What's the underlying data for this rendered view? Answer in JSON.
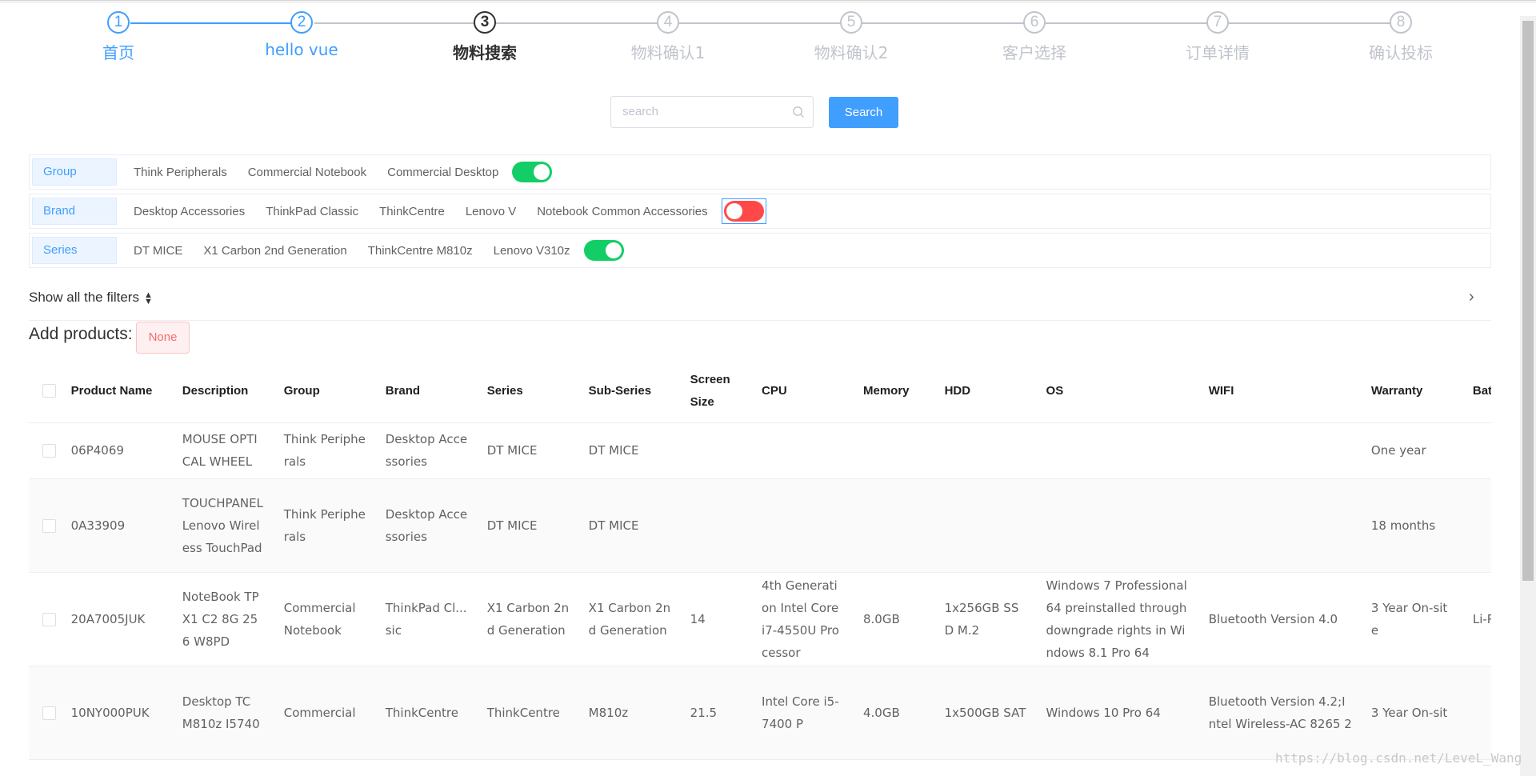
{
  "steps": [
    {
      "number": "1",
      "label": "首页",
      "state": "done"
    },
    {
      "number": "2",
      "label": "hello vue",
      "state": "done"
    },
    {
      "number": "3",
      "label": "物料搜索",
      "state": "active"
    },
    {
      "number": "4",
      "label": "物料确认1",
      "state": "pending"
    },
    {
      "number": "5",
      "label": "物料确认2",
      "state": "pending"
    },
    {
      "number": "6",
      "label": "客户选择",
      "state": "pending"
    },
    {
      "number": "7",
      "label": "订单详情",
      "state": "pending"
    },
    {
      "number": "8",
      "label": "确认投标",
      "state": "pending"
    }
  ],
  "search": {
    "placeholder": "search",
    "value": "",
    "button_label": "Search"
  },
  "filters": {
    "group": {
      "label": "Group",
      "options": [
        "Think Peripherals",
        "Commercial Notebook",
        "Commercial Desktop"
      ],
      "toggle": "on"
    },
    "brand": {
      "label": "Brand",
      "options": [
        "Desktop Accessories",
        "ThinkPad Classic",
        "ThinkCentre",
        "Lenovo V",
        "Notebook Common Accessories"
      ],
      "toggle": "off"
    },
    "series": {
      "label": "Series",
      "options": [
        "DT MICE",
        "X1 Carbon 2nd Generation",
        "ThinkCentre M810z",
        "Lenovo V310z"
      ],
      "toggle": "on"
    }
  },
  "show_filters_label": "Show all the filters",
  "add_products": {
    "label": "Add products:",
    "tag": "None"
  },
  "table": {
    "headers": [
      "Product Name",
      "Description",
      "Group",
      "Brand",
      "Series",
      "Sub-Series",
      "Screen Size",
      "CPU",
      "Memory",
      "HDD",
      "OS",
      "WIFI",
      "Warranty",
      "Battery"
    ],
    "rows": [
      [
        "06P4069",
        "MOUSE OPTICAL WHEEL",
        "Think Peripherals",
        "Desktop Accessories",
        "DT MICE",
        "DT MICE",
        "",
        "",
        "",
        "",
        "",
        "",
        "One year",
        ""
      ],
      [
        "0A33909",
        "TOUCHPANEL Lenovo Wireless TouchPad",
        "Think Peripherals",
        "Desktop Accessories",
        "DT MICE",
        "DT MICE",
        "",
        "",
        "",
        "",
        "",
        "",
        "18 months",
        ""
      ],
      [
        "20A7005JUK",
        "NoteBook TP X1 C2 8G 256 W8PD",
        "Commercial Notebook",
        "ThinkPad Cl...sic",
        "X1 Carbon 2nd Generation",
        "X1 Carbon 2nd Generation",
        "14",
        "4th Generation Intel Core i7-4550U Processor",
        "8.0GB",
        "1x256GB SSD M.2",
        "Windows 7 Professional 64 preinstalled through downgrade rights in Windows 8.1 Pro 64",
        "Bluetooth Version 4.0",
        "3 Year On-site",
        "Li-Polymer"
      ],
      [
        "10NY000PUK",
        "Desktop TC M810z I5740",
        "Commercial",
        "ThinkCentre",
        "ThinkCentre",
        "M810z",
        "21.5",
        "Intel Core i5-7400 P",
        "4.0GB",
        "1x500GB SAT",
        "Windows 10 Pro 64",
        "Bluetooth Version 4.2;Intel Wireless-AC 8265 2",
        "3 Year On-sit",
        ""
      ]
    ]
  },
  "watermark": "https://blog.csdn.net/LeveL_Wang"
}
